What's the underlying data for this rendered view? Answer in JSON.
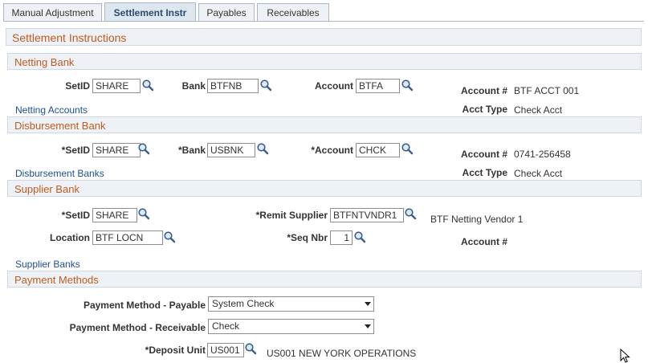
{
  "tabs": [
    {
      "label": "Manual Adjustment",
      "active": false
    },
    {
      "label": "Settlement Instr",
      "active": true
    },
    {
      "label": "Payables",
      "active": false
    },
    {
      "label": "Receivables",
      "active": false
    }
  ],
  "page_title": "Settlement Instructions",
  "netting_bank": {
    "title": "Netting Bank",
    "setid_label": "SetID",
    "setid": "SHARE",
    "bank_label": "Bank",
    "bank": "BTFNB",
    "account_label": "Account",
    "account": "BTFA",
    "acct_num_label": "Account #",
    "acct_num": "BTF ACCT 001",
    "acct_type_label": "Acct Type",
    "acct_type": "Check Acct",
    "link": "Netting Accounts"
  },
  "disbursement_bank": {
    "title": "Disbursement Bank",
    "setid_label": "*SetID",
    "setid": "SHARE",
    "bank_label": "*Bank",
    "bank": "USBNK",
    "account_label": "*Account",
    "account": "CHCK",
    "acct_num_label": "Account #",
    "acct_num": "0741-256458",
    "acct_type_label": "Acct Type",
    "acct_type": "Check Acct",
    "link": "Disbursement Banks"
  },
  "supplier_bank": {
    "title": "Supplier Bank",
    "setid_label": "*SetID",
    "setid": "SHARE",
    "remit_label": "*Remit Supplier",
    "remit": "BTFNTVNDR1",
    "remit_desc": "BTF Netting Vendor 1",
    "location_label": "Location",
    "location": "BTF LOCN",
    "seq_label": "*Seq Nbr",
    "seq": "1",
    "acct_num_label": "Account #",
    "link": "Supplier Banks"
  },
  "payment_methods": {
    "title": "Payment Methods",
    "payable_label": "Payment Method - Payable",
    "payable": "System Check",
    "receivable_label": "Payment Method - Receivable",
    "receivable": "Check",
    "deposit_label": "*Deposit Unit",
    "deposit": "US001",
    "deposit_desc": "US001 NEW YORK OPERATIONS"
  },
  "icons": {
    "lookup": "magnifier-icon",
    "dropdown": "chevron-down-icon",
    "cursor": "mouse-pointer-icon"
  }
}
